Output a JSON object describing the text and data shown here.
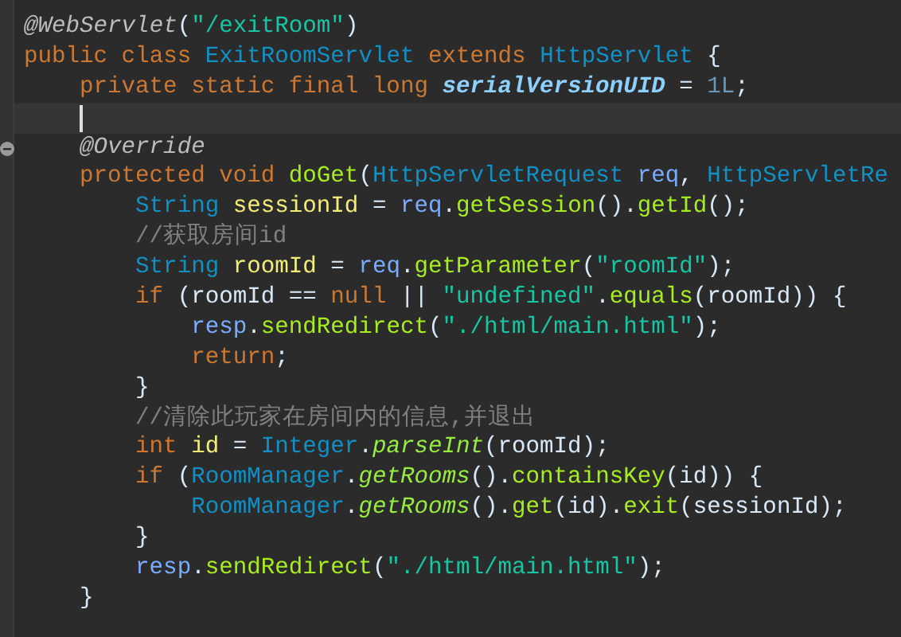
{
  "editor": {
    "lines": [
      {
        "current": false,
        "fold_marker": false,
        "tokens": [
          {
            "kind": "annot",
            "text": "@WebServlet"
          },
          {
            "kind": "plain",
            "text": "("
          },
          {
            "kind": "str",
            "text": "\"/exitRoom\""
          },
          {
            "kind": "plain",
            "text": ")"
          }
        ]
      },
      {
        "current": false,
        "fold_marker": false,
        "tokens": [
          {
            "kind": "kw",
            "text": "public class "
          },
          {
            "kind": "type",
            "text": "ExitRoomServlet"
          },
          {
            "kind": "kw",
            "text": " extends "
          },
          {
            "kind": "type",
            "text": "HttpServlet"
          },
          {
            "kind": "plain",
            "text": " {"
          }
        ],
        "children": [
          {
            "current": false,
            "fold_marker": false,
            "tokens": [
              {
                "kind": "kw",
                "text": "private static final long "
              },
              {
                "kind": "field",
                "text": "serialVersionUID"
              },
              {
                "kind": "plain",
                "text": " = "
              },
              {
                "kind": "num",
                "text": "1L"
              },
              {
                "kind": "plain",
                "text": ";"
              }
            ]
          },
          {
            "current": true,
            "fold_marker": false
          },
          {
            "current": false,
            "fold_marker": true,
            "tokens": [
              {
                "kind": "annot",
                "text": "@Override"
              }
            ]
          },
          {
            "current": false,
            "fold_marker": false,
            "tokens": [
              {
                "kind": "kw",
                "text": "protected void "
              },
              {
                "kind": "method",
                "text": "doGet"
              },
              {
                "kind": "plain",
                "text": "("
              },
              {
                "kind": "type",
                "text": "HttpServletRequest"
              },
              {
                "kind": "param",
                "text": " req"
              },
              {
                "kind": "plain",
                "text": ", "
              },
              {
                "kind": "type",
                "text": "HttpServletRe"
              }
            ],
            "children": [
              {
                "current": false,
                "fold_marker": false,
                "tokens": [
                  {
                    "kind": "type",
                    "text": "String "
                  },
                  {
                    "kind": "local",
                    "text": "sessionId"
                  },
                  {
                    "kind": "plain",
                    "text": " = "
                  },
                  {
                    "kind": "param",
                    "text": "req"
                  },
                  {
                    "kind": "plain",
                    "text": "."
                  },
                  {
                    "kind": "method",
                    "text": "getSession"
                  },
                  {
                    "kind": "plain",
                    "text": "()."
                  },
                  {
                    "kind": "method",
                    "text": "getId"
                  },
                  {
                    "kind": "plain",
                    "text": "();"
                  }
                ]
              },
              {
                "current": false,
                "fold_marker": false,
                "tokens": [
                  {
                    "kind": "comment",
                    "text": "//获取房间id"
                  }
                ]
              },
              {
                "current": false,
                "fold_marker": false,
                "tokens": [
                  {
                    "kind": "type",
                    "text": "String "
                  },
                  {
                    "kind": "local",
                    "text": "roomId"
                  },
                  {
                    "kind": "plain",
                    "text": " = "
                  },
                  {
                    "kind": "param",
                    "text": "req"
                  },
                  {
                    "kind": "plain",
                    "text": "."
                  },
                  {
                    "kind": "method",
                    "text": "getParameter"
                  },
                  {
                    "kind": "plain",
                    "text": "("
                  },
                  {
                    "kind": "str",
                    "text": "\"roomId\""
                  },
                  {
                    "kind": "plain",
                    "text": ");"
                  }
                ]
              },
              {
                "current": false,
                "fold_marker": false,
                "tokens": [
                  {
                    "kind": "kw",
                    "text": "if"
                  },
                  {
                    "kind": "plain",
                    "text": " (roomId == "
                  },
                  {
                    "kind": "kw",
                    "text": "null"
                  },
                  {
                    "kind": "plain",
                    "text": " || "
                  },
                  {
                    "kind": "str",
                    "text": "\"undefined\""
                  },
                  {
                    "kind": "plain",
                    "text": "."
                  },
                  {
                    "kind": "method",
                    "text": "equals"
                  },
                  {
                    "kind": "plain",
                    "text": "(roomId)) {"
                  }
                ],
                "children": [
                  {
                    "current": false,
                    "fold_marker": false,
                    "tokens": [
                      {
                        "kind": "param",
                        "text": "resp"
                      },
                      {
                        "kind": "plain",
                        "text": "."
                      },
                      {
                        "kind": "method",
                        "text": "sendRedirect"
                      },
                      {
                        "kind": "plain",
                        "text": "("
                      },
                      {
                        "kind": "str",
                        "text": "\"./html/main.html\""
                      },
                      {
                        "kind": "plain",
                        "text": ");"
                      }
                    ]
                  },
                  {
                    "current": false,
                    "fold_marker": false,
                    "tokens": [
                      {
                        "kind": "kw",
                        "text": "return"
                      },
                      {
                        "kind": "plain",
                        "text": ";"
                      }
                    ]
                  }
                ]
              },
              {
                "current": false,
                "fold_marker": false,
                "tokens": [
                  {
                    "kind": "plain",
                    "text": "}"
                  }
                ]
              },
              {
                "current": false,
                "fold_marker": false,
                "tokens": [
                  {
                    "kind": "comment",
                    "text": "//清除此玩家在房间内的信息,并退出"
                  }
                ]
              },
              {
                "current": false,
                "fold_marker": false,
                "tokens": [
                  {
                    "kind": "kw",
                    "text": "int "
                  },
                  {
                    "kind": "local",
                    "text": "id"
                  },
                  {
                    "kind": "plain",
                    "text": " = "
                  },
                  {
                    "kind": "type",
                    "text": "Integer"
                  },
                  {
                    "kind": "plain",
                    "text": "."
                  },
                  {
                    "kind": "smethod",
                    "text": "parseInt"
                  },
                  {
                    "kind": "plain",
                    "text": "(roomId);"
                  }
                ]
              },
              {
                "current": false,
                "fold_marker": false,
                "tokens": [
                  {
                    "kind": "kw",
                    "text": "if"
                  },
                  {
                    "kind": "plain",
                    "text": " ("
                  },
                  {
                    "kind": "type",
                    "text": "RoomManager"
                  },
                  {
                    "kind": "plain",
                    "text": "."
                  },
                  {
                    "kind": "smethod",
                    "text": "getRooms"
                  },
                  {
                    "kind": "plain",
                    "text": "()."
                  },
                  {
                    "kind": "method",
                    "text": "containsKey"
                  },
                  {
                    "kind": "plain",
                    "text": "(id)) {"
                  }
                ],
                "children": [
                  {
                    "current": false,
                    "fold_marker": false,
                    "tokens": [
                      {
                        "kind": "type",
                        "text": "RoomManager"
                      },
                      {
                        "kind": "plain",
                        "text": "."
                      },
                      {
                        "kind": "smethod",
                        "text": "getRooms"
                      },
                      {
                        "kind": "plain",
                        "text": "()."
                      },
                      {
                        "kind": "method",
                        "text": "get"
                      },
                      {
                        "kind": "plain",
                        "text": "(id)."
                      },
                      {
                        "kind": "method",
                        "text": "exit"
                      },
                      {
                        "kind": "plain",
                        "text": "(sessionId);"
                      }
                    ]
                  }
                ]
              },
              {
                "current": false,
                "fold_marker": false,
                "tokens": [
                  {
                    "kind": "plain",
                    "text": "}"
                  }
                ]
              },
              {
                "current": false,
                "fold_marker": false,
                "tokens": [
                  {
                    "kind": "param",
                    "text": "resp"
                  },
                  {
                    "kind": "plain",
                    "text": "."
                  },
                  {
                    "kind": "method",
                    "text": "sendRedirect"
                  },
                  {
                    "kind": "plain",
                    "text": "("
                  },
                  {
                    "kind": "str",
                    "text": "\"./html/main.html\""
                  },
                  {
                    "kind": "plain",
                    "text": ");"
                  }
                ]
              }
            ]
          },
          {
            "current": false,
            "fold_marker": false,
            "tokens": [
              {
                "kind": "plain",
                "text": "}"
              }
            ]
          }
        ]
      }
    ]
  }
}
